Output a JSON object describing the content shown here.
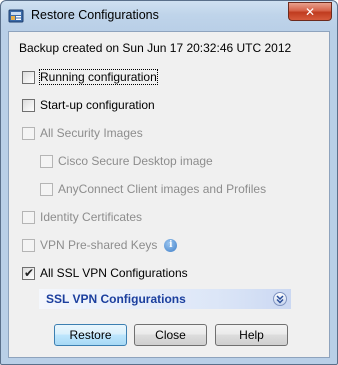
{
  "window": {
    "title": "Restore Configurations",
    "close_glyph": "✕"
  },
  "backup_info": "Backup created on Sun Jun 17 20:32:46 UTC 2012",
  "options": [
    {
      "label": "Running configuration",
      "checked": false,
      "enabled": true
    },
    {
      "label": "Start-up configuration",
      "checked": false,
      "enabled": true
    },
    {
      "label": "All Security Images",
      "checked": false,
      "enabled": false
    },
    {
      "label": "Cisco Secure Desktop image",
      "checked": false,
      "enabled": false
    },
    {
      "label": "AnyConnect Client images and Profiles",
      "checked": false,
      "enabled": false
    },
    {
      "label": "Identity Certificates",
      "checked": false,
      "enabled": false
    },
    {
      "label": "VPN Pre-shared Keys",
      "checked": false,
      "enabled": false
    },
    {
      "label": "All SSL VPN Configurations",
      "checked": true,
      "enabled": true
    }
  ],
  "info_glyph": "i",
  "ssl_section": {
    "title": "SSL VPN Configurations",
    "expand_icon": "double-chevron-down-icon"
  },
  "buttons": {
    "restore": "Restore",
    "close": "Close",
    "help": "Help"
  },
  "colors": {
    "section_title": "#1b3f9e",
    "close_button": "#c03b1f",
    "disabled_text": "#8d8d8d"
  }
}
